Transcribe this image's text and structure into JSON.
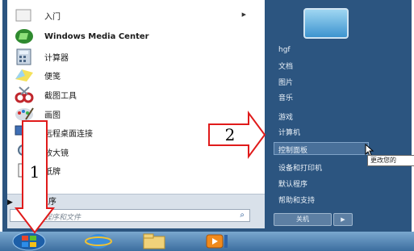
{
  "programs": [
    {
      "label": "入门",
      "has_arrow": true
    },
    {
      "label": "Windows Media Center",
      "has_arrow": false
    },
    {
      "label": "计算器",
      "has_arrow": false
    },
    {
      "label": "便笺",
      "has_arrow": false
    },
    {
      "label": "截图工具",
      "has_arrow": false
    },
    {
      "label": "画图",
      "has_arrow": false
    },
    {
      "label": "远程桌面连接",
      "has_arrow": false
    },
    {
      "label": "放大镜",
      "has_arrow": false
    },
    {
      "label": "纸牌",
      "has_arrow": false
    }
  ],
  "all_programs": "所有程序",
  "search_placeholder": "搜索程序和文件",
  "right_items": [
    "hgf",
    "文档",
    "图片",
    "音乐",
    "游戏",
    "计算机",
    "控制面板",
    "设备和打印机",
    "默认程序",
    "帮助和支持"
  ],
  "shutdown_label": "关机",
  "shutdown_arrow": "▶",
  "tooltip": "更改您的",
  "annotations": {
    "arrow1_label": "1",
    "arrow2_label": "2"
  },
  "colors": {
    "menu_right_bg": "#2c5580",
    "annotation_red": "#e01b1b"
  },
  "icons": {
    "arrow": "chevron-right-icon",
    "search": "search-icon"
  }
}
